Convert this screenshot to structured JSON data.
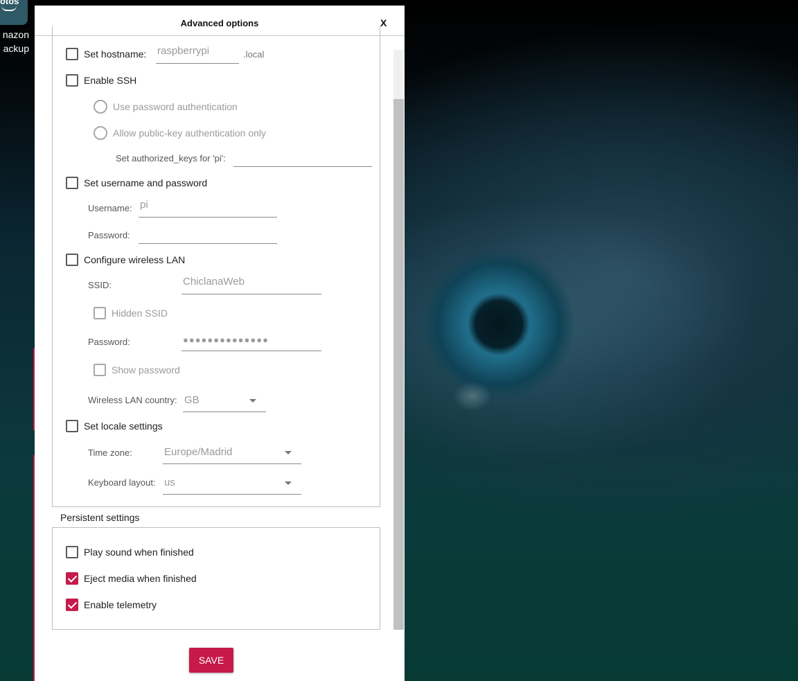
{
  "desktop": {
    "icon_tile_text": "hotos",
    "icon_caption_line1": "nazon",
    "icon_caption_line2": "ackup"
  },
  "dialog": {
    "title": "Advanced options",
    "close_label": "X"
  },
  "hostname": {
    "label": "Set hostname:",
    "value": "raspberrypi",
    "suffix": ".local",
    "checked": false
  },
  "ssh": {
    "label": "Enable SSH",
    "checked": false,
    "password_auth_label": "Use password authentication",
    "pubkey_auth_label": "Allow public-key authentication only",
    "authorized_keys_label": "Set authorized_keys for 'pi':",
    "authorized_keys_value": ""
  },
  "user": {
    "label": "Set username and password",
    "checked": false,
    "username_label": "Username:",
    "username_value": "pi",
    "password_label": "Password:",
    "password_value": ""
  },
  "wifi": {
    "label": "Configure wireless LAN",
    "checked": false,
    "ssid_label": "SSID:",
    "ssid_value": "ChiclanaWeb",
    "hidden_ssid_label": "Hidden SSID",
    "password_label": "Password:",
    "password_value": "●●●●●●●●●●●●●●",
    "show_password_label": "Show password",
    "country_label": "Wireless LAN country:",
    "country_value": "GB"
  },
  "locale": {
    "label": "Set locale settings",
    "checked": false,
    "timezone_label": "Time zone:",
    "timezone_value": "Europe/Madrid",
    "keyboard_label": "Keyboard layout:",
    "keyboard_value": "us"
  },
  "persistent": {
    "title": "Persistent settings",
    "play_sound_label": "Play sound when finished",
    "play_sound_checked": false,
    "eject_label": "Eject media when finished",
    "eject_checked": true,
    "telemetry_label": "Enable telemetry",
    "telemetry_checked": true
  },
  "actions": {
    "save_label": "SAVE"
  },
  "colors": {
    "accent": "#c51a4a",
    "disabled_text": "#9a9a9a"
  }
}
